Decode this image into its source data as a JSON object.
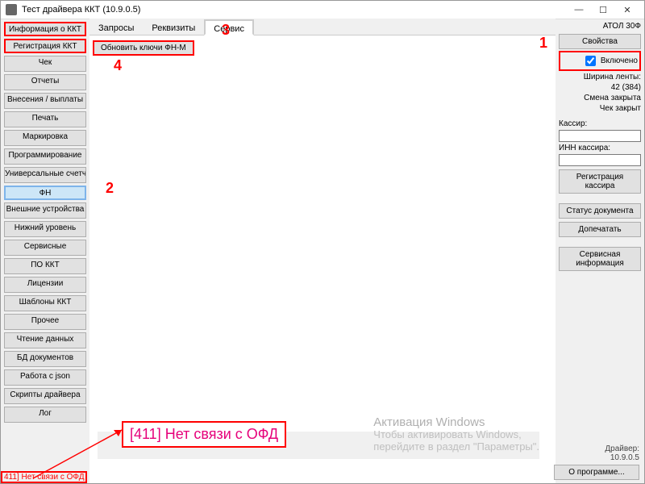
{
  "window": {
    "title": "Тест драйвера ККТ (10.9.0.5)"
  },
  "wincontrols": {
    "min": "—",
    "max": "☐",
    "close": "✕"
  },
  "sidebar": {
    "items": [
      {
        "label": "Информация о ККТ"
      },
      {
        "label": "Регистрация ККТ"
      },
      {
        "label": "Чек"
      },
      {
        "label": "Отчеты"
      },
      {
        "label": "Внесения / выплаты"
      },
      {
        "label": "Печать"
      },
      {
        "label": "Маркировка"
      },
      {
        "label": "Программирование"
      },
      {
        "label": "Универсальные счетчики"
      },
      {
        "label": "ФН"
      },
      {
        "label": "Внешние устройства"
      },
      {
        "label": "Нижний уровень"
      },
      {
        "label": "Сервисные"
      },
      {
        "label": "ПО ККТ"
      },
      {
        "label": "Лицензии"
      },
      {
        "label": "Шаблоны ККТ"
      },
      {
        "label": "Прочее"
      },
      {
        "label": "Чтение данных"
      },
      {
        "label": "БД документов"
      },
      {
        "label": "Работа с json"
      },
      {
        "label": "Скрипты драйвера"
      },
      {
        "label": "Лог"
      }
    ]
  },
  "tabs": {
    "items": [
      {
        "label": "Запросы"
      },
      {
        "label": "Реквизиты"
      },
      {
        "label": "Сервис"
      }
    ],
    "subbutton": "Обновить ключи ФН-М"
  },
  "right": {
    "device": "АТОЛ 30Ф",
    "properties_btn": "Свойства",
    "enabled_label": "Включено",
    "tape_label": "Ширина ленты:",
    "tape_value": "42 (384)",
    "shift": "Смена закрыта",
    "check": "Чек закрыт",
    "cashier_label": "Кассир:",
    "cashier_value": "",
    "inn_label": "ИНН кассира:",
    "inn_value": "",
    "reg_btn": "Регистрация кассира",
    "status_btn": "Статус документа",
    "finish_btn": "Допечатать",
    "service_btn": "Сервисная информация",
    "driver_label": "Драйвер:",
    "driver_version": "10.9.0.5",
    "about_btn": "О программе..."
  },
  "annotations": {
    "a1": "1",
    "a2": "2",
    "a3": "3",
    "a4": "4"
  },
  "error": {
    "big": "[411] Нет связи с ОФД",
    "small": "411] Нет связи с ОФД"
  },
  "watermark": {
    "l1": "Активация Windows",
    "l2": "Чтобы активировать Windows,",
    "l3": "перейдите в раздел \"Параметры\"."
  }
}
